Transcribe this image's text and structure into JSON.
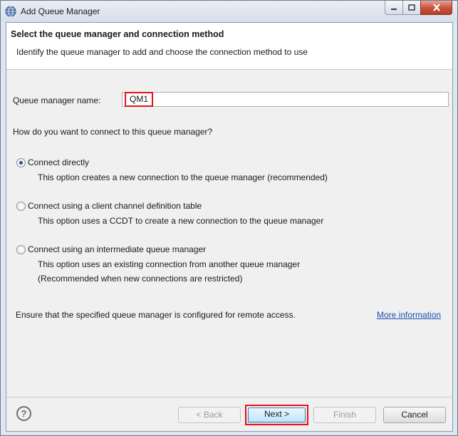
{
  "window": {
    "title": "Add Queue Manager",
    "icon": "app-globe-icon"
  },
  "banner": {
    "title": "Select the queue manager and connection method",
    "description": "Identify the queue manager to add and choose the connection method to use"
  },
  "form": {
    "qm_label": "Queue manager name:",
    "qm_value": "QM1",
    "question": "How do you want to connect to this queue manager?"
  },
  "options": [
    {
      "label": "Connect directly",
      "desc": "This option creates a new connection to the queue manager (recommended)",
      "desc2": "",
      "checked": true
    },
    {
      "label": "Connect using a client channel definition table",
      "desc": "This option uses a CCDT to create a new connection to the queue manager",
      "desc2": "",
      "checked": false
    },
    {
      "label": "Connect using an intermediate queue manager",
      "desc": "This option uses an existing connection from another queue manager",
      "desc2": "(Recommended when new connections are restricted)",
      "checked": false
    }
  ],
  "footer_note": "Ensure that the specified queue manager is configured for remote access.",
  "more_info_link": "More information",
  "buttons": {
    "help": "?",
    "back": "< Back",
    "next": "Next >",
    "finish": "Finish",
    "cancel": "Cancel"
  },
  "colors": {
    "highlight": "#e8101a",
    "link": "#1d4fb1"
  }
}
